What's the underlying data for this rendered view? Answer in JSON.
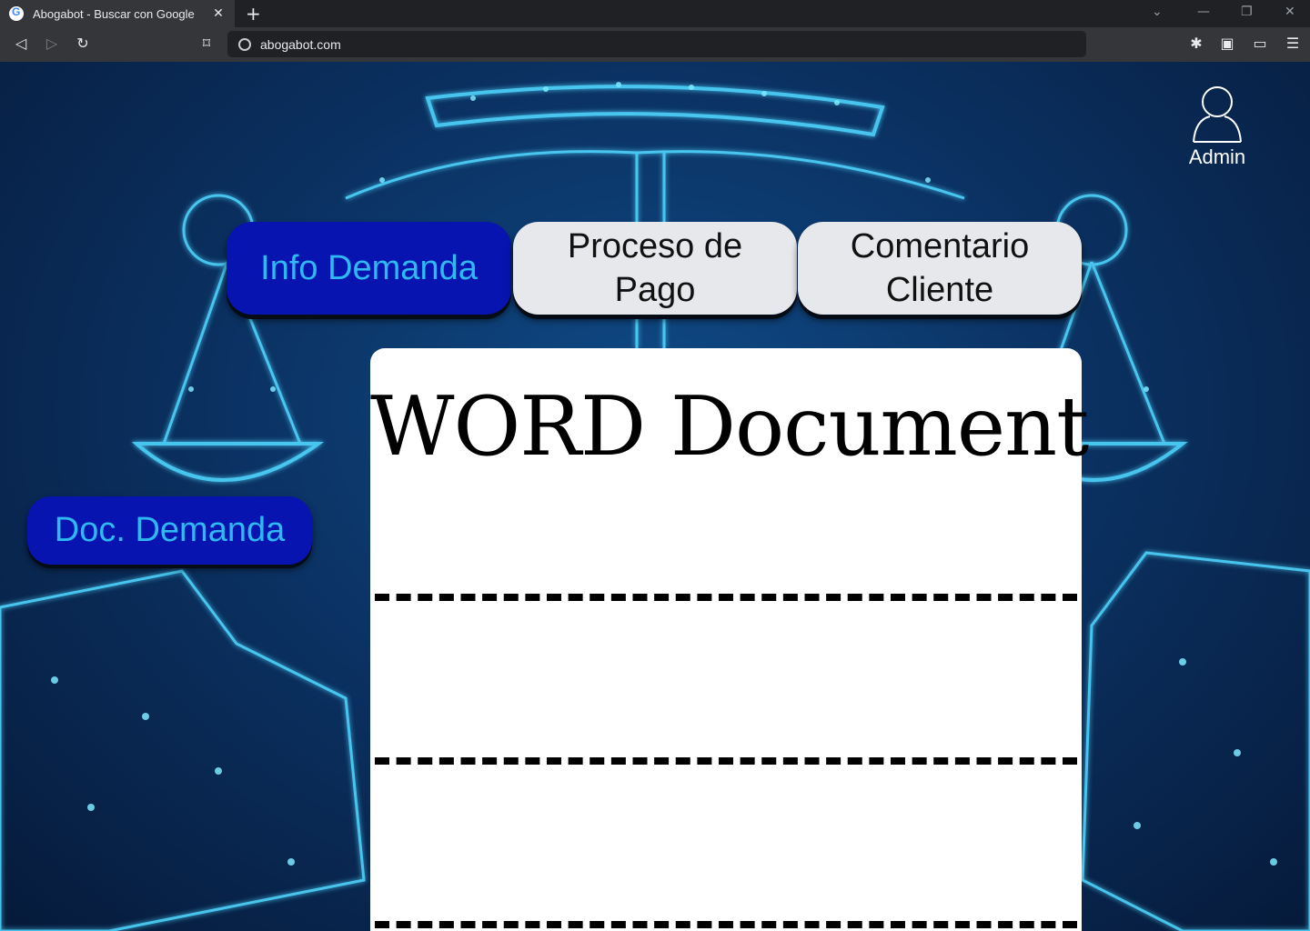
{
  "browser": {
    "tab_title": "Abogabot - Buscar con Google",
    "new_tab_icon": "plus-icon",
    "url": "abogabot.com"
  },
  "header": {
    "user_label": "Admin",
    "user_icon": "user-icon"
  },
  "nav": {
    "tabs": [
      {
        "label": "Info Demanda",
        "active": true
      },
      {
        "label": "Proceso de\nPago",
        "active": false
      },
      {
        "label": "Comentario\nCliente",
        "active": false
      }
    ]
  },
  "sidebar": {
    "doc_button_label": "Doc. Demanda"
  },
  "document": {
    "title": "WORD Document"
  },
  "colors": {
    "active_tab_bg": "#0714b0",
    "active_tab_text": "#2fb8f2",
    "inactive_tab_bg": "#e6e8ec",
    "chrome_bg": "#35363a"
  }
}
